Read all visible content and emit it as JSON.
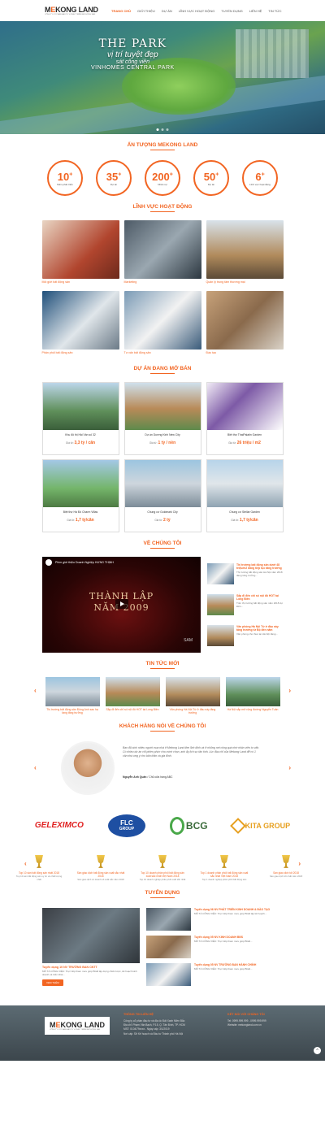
{
  "header": {
    "logo_text_a": "M",
    "logo_text_b": "KONG",
    "logo_text_c": " LAND",
    "logo_tagline": "CÔNG TY CỔ PHẦN ĐẦU TƯ & PHÁT TRIỂN BẤT ĐỘNG SẢN",
    "nav": [
      "TRANG CHỦ",
      "GIỚI THIỆU",
      "DỰ ÁN",
      "LĨNH VỰC HOẠT ĐỘNG",
      "TUYỂN DỤNG",
      "LIÊN HỆ",
      "TIN TỨC"
    ]
  },
  "hero": {
    "line1": "THE PARK",
    "line2": "vị trí tuyệt đẹp",
    "line3": "sát công viên",
    "line4": "VINHOMES CENTRAL PARK"
  },
  "impressions": {
    "title": "ẤN TƯỢNG MEKONG LAND",
    "stats": [
      {
        "num": "10",
        "label": "Năm phát triển"
      },
      {
        "num": "35",
        "label": "Dự án"
      },
      {
        "num": "200",
        "label": "Nhân sự"
      },
      {
        "num": "50",
        "label": "Dự án"
      },
      {
        "num": "6",
        "label": "Lĩnh vực hoạt động"
      }
    ]
  },
  "fields": {
    "title": "LĨNH VỰC HOẠT ĐỘNG",
    "items": [
      {
        "caption": "Môi giới bất động sản"
      },
      {
        "caption": "Marketing"
      },
      {
        "caption": "Quản lý trung tâm thương mại"
      },
      {
        "caption": "Phân phối bất động sản"
      },
      {
        "caption": "Tư vấn bất động sản"
      },
      {
        "caption": "Đào tạo"
      }
    ]
  },
  "projects": {
    "title": "DỰ ÁN ĐANG MỞ BÁN",
    "price_label": "Giá từ:",
    "items": [
      {
        "name": "Khu đô thị Hải Vân số 32",
        "price": "3,3 tỷ / căn"
      },
      {
        "name": "Dự án Dương Kinh New City",
        "price": "1 tỷ / nền"
      },
      {
        "name": "Biệt thự ThaiPalatin Garden",
        "price": "26 triệu / m2"
      },
      {
        "name": "Biệt thự Hà Đô Charm Villas",
        "price": "1,7 tỷ/căn"
      },
      {
        "name": "Chung cư Goldmark City",
        "price": "2 tỷ"
      },
      {
        "name": "Chung cư Stellar Garden",
        "price": "1,7 tỷ/căn"
      }
    ]
  },
  "about": {
    "title": "VỀ CHÚNG TÔI",
    "video_title": "Phim giới thiệu Doanh Nghiệp HƯNG THỊNH",
    "video_line1": "THÀNH LẬP",
    "video_line2": "NĂM 2009",
    "video_brand": "SAM",
    "side": [
      {
        "title": "Thị trường bất động sản dưới 48 triệu/m2 đang tiếp tục tăng trưởng",
        "desc": "Thị trường bất động sản Hà Nội năm 2018 đang tăng trưởng..."
      },
      {
        "title": "Sắp đi đến chỉ số nội đô HOT tại Long Biên",
        "desc": "Trên thị trường bất động sản năm 2018 dự kiến..."
      },
      {
        "title": "Văn phòng Hà Nội Từ ở đầu này tăng trưởng từ Bộ đến năm",
        "desc": "Văn phòng cho thuê tại Hà Nội đang..."
      }
    ]
  },
  "news": {
    "title": "TIN TỨC MỚI",
    "items": [
      {
        "title": "Thị trường bất động sản Đông Anh sau hạ tầng tăng trưởng"
      },
      {
        "title": "Sắp đi đến chỉ số nội đô HOT tại Long Biên"
      },
      {
        "title": "Văn phòng Hà Nội Từ ở đầu này tăng trưởng"
      },
      {
        "title": "Hà Nội sắp mở rộng đường Nguyễn Tuân"
      }
    ]
  },
  "testimonials": {
    "title": "KHÁCH HÀNG NÓI VỀ CHÚNG TÔI",
    "quote": "Bạn đã sinh nhiều người mua nhà ở Mekong Land đơn lĩnh định và ở những nơi công quá nhờ nhân viên tư vấn. Có nhiều dự án chỉ phiền phức cho mình chọn, anh ấy lịch sự tận tình. Lúc đầu chỉ của Mekong Land để có 1 căn nhà ưng ý cho bản thân và gia đình.",
    "name": "Nguyễn Anh Quân",
    "role": " / Chủ cửa hàng ABC"
  },
  "partners": {
    "p1": "GELEXIMCO",
    "p2a": "FLC",
    "p2b": "GROUP",
    "p3": "BCG",
    "p4a": "KITA",
    "p4b": "GROUP"
  },
  "awards": [
    {
      "title": "Top 10 sàn bất động sản nhất 2018",
      "desc": "Top 10 sàn bất động sản uy tín và chất lượng nhất"
    },
    {
      "title": "Sàn giao dịch bất động sản xuất sắc nhất 2018",
      "desc": "Sàn giao dịch có doanh số xuất sắc năm 2018"
    },
    {
      "title": "Top 10 doanh phân phối bất động sản xuất sắc nhất Việt Nam 2018",
      "desc": "Top 10 doanh nghiệp phân phối xuất sắc nhất"
    },
    {
      "title": "Top 1 doanh phân phối bất động sản xuất sắc nhất Việt Nam 2018",
      "desc": "Top 1 doanh nghiệp phân phối bất động sản"
    },
    {
      "title": "Sàn giao dịch tốt 2018",
      "desc": "Sàn giao dịch tốt nhất năm 2018"
    }
  ],
  "careers": {
    "title": "TUYỂN DỤNG",
    "main_title": "Tuyển dụng 10 NV TRƯỜNG BAN CNTT",
    "main_desc": "MÔ TẢ CÔNG VIỆC: Trực tiếp tham mưu giúp BGĐ lập dựng chiến lược, kế hoạch kinh doanh và triển khai...",
    "button": "XEM THÊM",
    "list": [
      {
        "title": "Tuyển dụng 06 NV PHÁT TRIỂN KINH DOANH & ĐÀO TẠO",
        "desc": "MÔ TẢ CÔNG VIỆC: Trực tiếp tham mưu giúp BGĐ lập kế hoạch..."
      },
      {
        "title": "Tuyển dụng 05 NV KINH DOANH BĐS",
        "desc": "MÔ TẢ CÔNG VIỆC: Trực tiếp tham mưu giúp BGĐ..."
      },
      {
        "title": "Tuyển dụng 05 NV TRƯỞNG BAN HÀNH CHÍNH",
        "desc": "MÔ TẢ CÔNG VIỆC: Trực tiếp tham mưu giúp BGĐ..."
      }
    ]
  },
  "footer": {
    "col1_title": "THÔNG TIN LIÊN HỆ",
    "col1_lines": [
      "Công ty cổ phần đầu tư và địa ốc Đất Xanh Miền Bắc",
      "Địa chỉ: Phạm Văn Bạch, P.15, Q. Tân Bình, TP. HCM",
      "MST: 0104/79xxxx - Ngày cấp: 3/1/2019",
      "Nơi cấp: Sở Kế hoạch và Đầu tư Thành phố Hà Nội"
    ],
    "col2_title": "KẾT NỐI VỚI CHÚNG TÔI",
    "col2_lines": [
      "Tel: 0999.999.999 - 0999.999.999",
      "Website: mekongland.com.vn"
    ],
    "totop": "^"
  }
}
